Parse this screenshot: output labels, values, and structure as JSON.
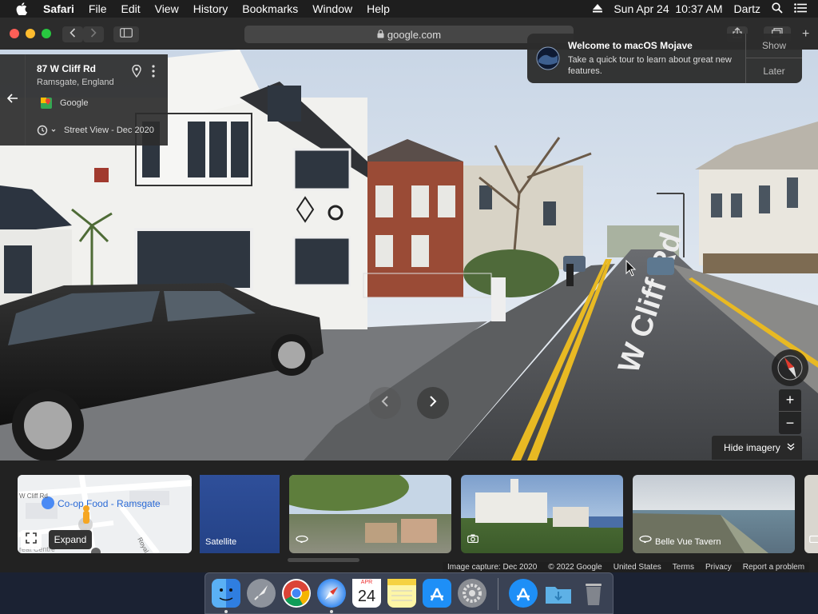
{
  "menubar": {
    "app": "Safari",
    "items": [
      "File",
      "Edit",
      "View",
      "History",
      "Bookmarks",
      "Window",
      "Help"
    ],
    "datetime": "Sun Apr 24  10:37 AM",
    "user": "Dartz"
  },
  "safari": {
    "url": "google.com"
  },
  "location": {
    "title": "87 W Cliff Rd",
    "subtitle": "Ramsgate, England",
    "provider": "Google",
    "date": "Street View - Dec 2020"
  },
  "street": {
    "road_text": "W Cliff Rd"
  },
  "notification": {
    "title": "Welcome to macOS Mojave",
    "body": "Take a quick tour to learn about great new features.",
    "show": "Show",
    "later": "Later"
  },
  "controls": {
    "hide_imagery": "Hide imagery",
    "zoom_in": "+",
    "zoom_out": "−",
    "expand": "Expand"
  },
  "strip": {
    "map_label": "Co-op Food - Ramsgate",
    "map_streets": [
      "W Cliff Rd",
      "Royal Rd"
    ],
    "map_fragment": "reat Centre",
    "thumbs": [
      {
        "label": "Satellite"
      },
      {
        "label": ""
      },
      {
        "label": ""
      },
      {
        "label": "Belle Vue Tavern"
      }
    ]
  },
  "footer": {
    "items": [
      "Image capture: Dec 2020",
      "© 2022 Google",
      "United States",
      "Terms",
      "Privacy",
      "Report a problem"
    ]
  },
  "dock": {
    "calendar_month": "APR",
    "calendar_day": "24"
  },
  "colors": {
    "yellow_line": "#e8b923",
    "sky": "#dfe8f3",
    "accent_blue": "#2e7bf6"
  }
}
